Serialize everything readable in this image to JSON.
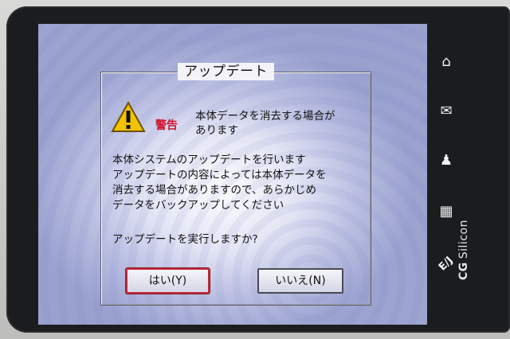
{
  "dialog": {
    "title": "アップデート",
    "warning_label": "警告",
    "warning_text": "本体データを消去する場合が\nあります",
    "body_lines": [
      "本体システムのアップデートを行います",
      "アップデートの内容によっては本体データを",
      "消去する場合がありますので、あらかじめ",
      "データをバックアップしてください"
    ],
    "question": "アップデートを実行しますか?",
    "yes_label": "はい(Y)",
    "no_label": "いいえ(N)"
  },
  "side_buttons": [
    {
      "icon": "home-icon",
      "glyph": "⌂"
    },
    {
      "icon": "mail-icon",
      "glyph": "✉"
    },
    {
      "icon": "contacts-icon",
      "glyph": "♟"
    },
    {
      "icon": "calculator-icon",
      "glyph": "▦"
    },
    {
      "icon": "dictionary-icon",
      "glyph": "E/J"
    }
  ],
  "logo": {
    "brand": "CG",
    "name": "Silicon"
  },
  "colors": {
    "warning_red": "#d0102a",
    "bezel": "#1b1c1e"
  }
}
